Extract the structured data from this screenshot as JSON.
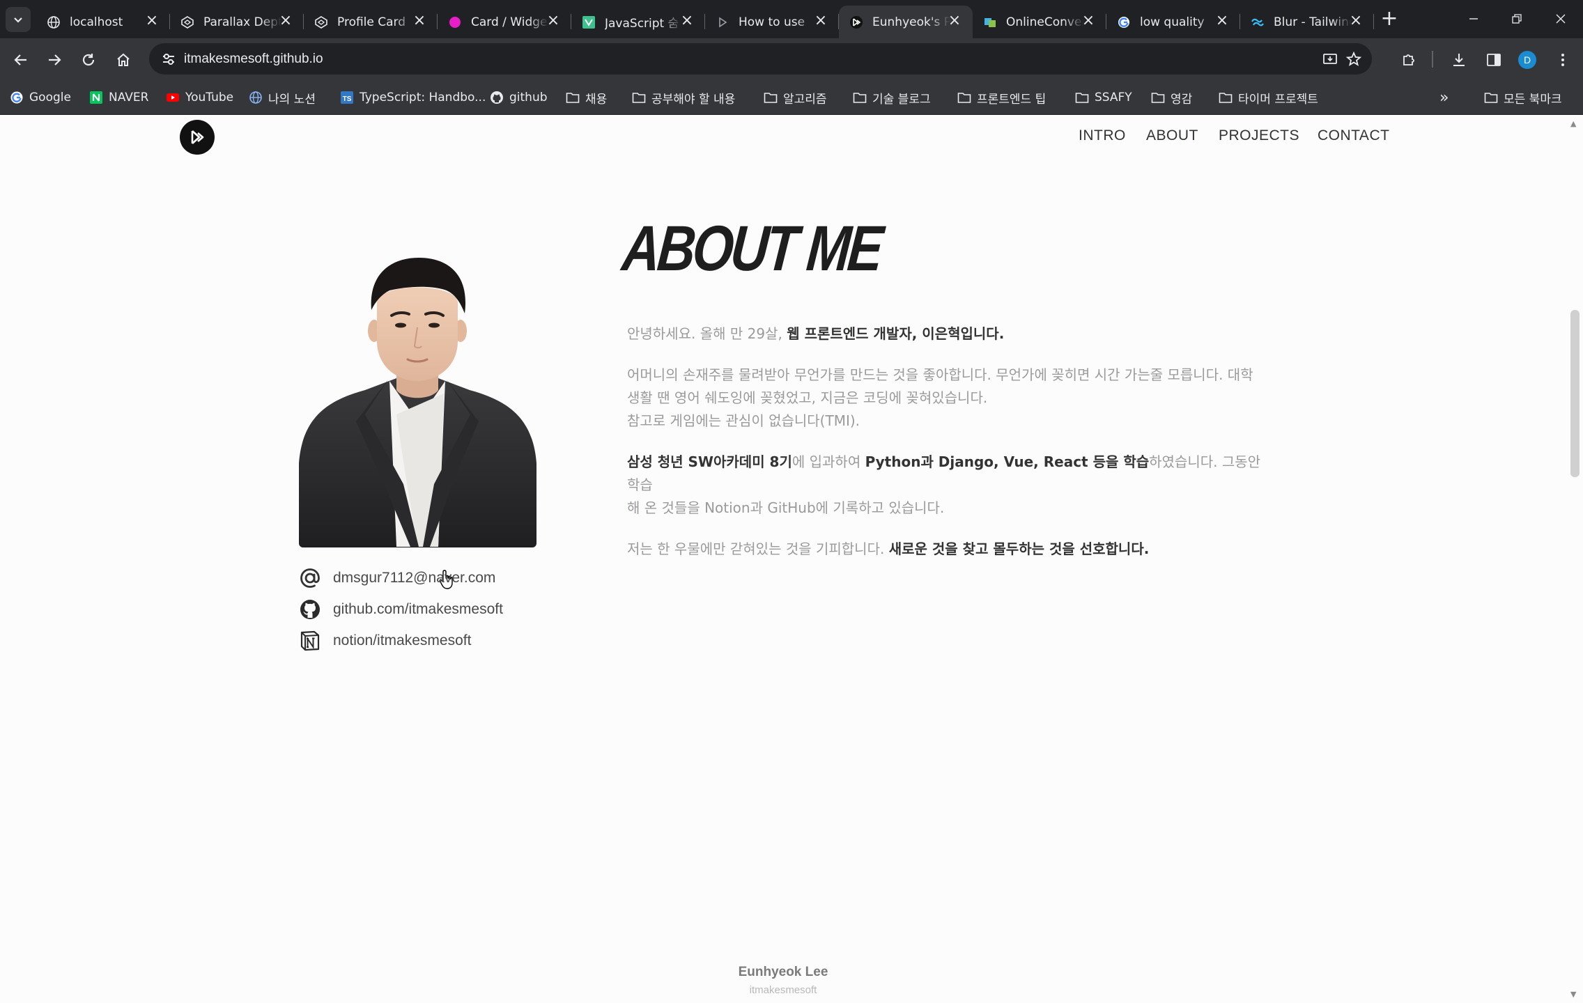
{
  "browser": {
    "tabs": [
      {
        "title": "localhost",
        "icon": "globe-icon",
        "active": false
      },
      {
        "title": "Parallax Depth",
        "icon": "codepen-icon",
        "active": false
      },
      {
        "title": "Profile Card",
        "icon": "codepen-icon",
        "active": false
      },
      {
        "title": "Card / Widget",
        "icon": "magenta-dot-icon",
        "active": false
      },
      {
        "title": "JavaScript 숨",
        "icon": "vue-icon",
        "active": false
      },
      {
        "title": "How to use",
        "icon": "play-icon",
        "active": false
      },
      {
        "title": "Eunhyeok's Portfolio",
        "icon": "site-logo-icon",
        "active": true
      },
      {
        "title": "OnlineConvert",
        "icon": "convert-icon",
        "active": false
      },
      {
        "title": "low quality",
        "icon": "google-icon",
        "active": false
      },
      {
        "title": "Blur - Tailwind",
        "icon": "tailwind-icon",
        "active": false
      }
    ],
    "url": "itmakesmesoft.github.io",
    "profile_initial": "D",
    "bookmarks": [
      {
        "label": "Google",
        "icon": "google-icon"
      },
      {
        "label": "NAVER",
        "icon": "naver-icon"
      },
      {
        "label": "YouTube",
        "icon": "youtube-icon"
      },
      {
        "label": "나의 노션",
        "icon": "globe-icon"
      },
      {
        "label": "TypeScript: Handbo...",
        "icon": "typescript-icon"
      },
      {
        "label": "github",
        "icon": "github-icon"
      },
      {
        "label": "채용",
        "icon": "folder-icon"
      },
      {
        "label": "공부해야 할 내용",
        "icon": "folder-icon"
      },
      {
        "label": "알고리즘",
        "icon": "folder-icon"
      },
      {
        "label": "기술 블로그",
        "icon": "folder-icon"
      },
      {
        "label": "프론트엔드 팁",
        "icon": "folder-icon"
      },
      {
        "label": "SSAFY",
        "icon": "folder-icon"
      },
      {
        "label": "영감",
        "icon": "folder-icon"
      },
      {
        "label": "타이머 프로젝트",
        "icon": "folder-icon"
      }
    ],
    "overflow_label": "»",
    "all_bookmarks_label": "모든 북마크"
  },
  "site": {
    "nav": [
      "INTRO",
      "ABOUT",
      "PROJECTS",
      "CONTACT"
    ],
    "about_title": "ABOUT ME",
    "bio": {
      "p1_plain": "안녕하세요. 올해 만 29살, ",
      "p1_bold": "웹 프론트엔드 개발자, 이은혁입니다.",
      "p2_line1": "어머니의 손재주를 물려받아 무언가를 만드는 것을 좋아합니다. 무언가에 꽂히면 시간 가는줄 모릅니다. 대학",
      "p2_line2": "생활 땐 영어 쉐도잉에 꽂혔었고, 지금은 코딩에 꽂혀있습니다.",
      "p2_line3": "참고로 게임에는 관심이 없습니다(TMI).",
      "p3_bold1": "삼성 청년 SW아카데미 8기",
      "p3_plain1": "에 입과하여 ",
      "p3_bold2": "Python과 Django, Vue, React 등을 학습",
      "p3_plain2": "하였습니다. 그동안 학습",
      "p3_line2": "해 온 것들을 Notion과 GitHub에 기록하고 있습니다.",
      "p4_plain": "저는 한 우물에만 갇혀있는 것을 기피합니다. ",
      "p4_bold": "새로운 것을 찾고 몰두하는 것을 선호합니다."
    },
    "contacts": [
      {
        "icon": "at-sign-icon",
        "text": "dmsgur7112@naver.com"
      },
      {
        "icon": "github-icon",
        "text": "github.com/itmakesmesoft"
      },
      {
        "icon": "notion-icon",
        "text": "notion/itmakesmesoft"
      }
    ],
    "footer": {
      "name": "Eunhyeok Lee",
      "handle": "itmakesmesoft"
    }
  },
  "colors": {
    "page_bg": "#fdfcfd",
    "chrome_dark": "#202124",
    "chrome_mid": "#35363a",
    "text_dark": "#333333",
    "text_muted": "#9a9a9a"
  }
}
